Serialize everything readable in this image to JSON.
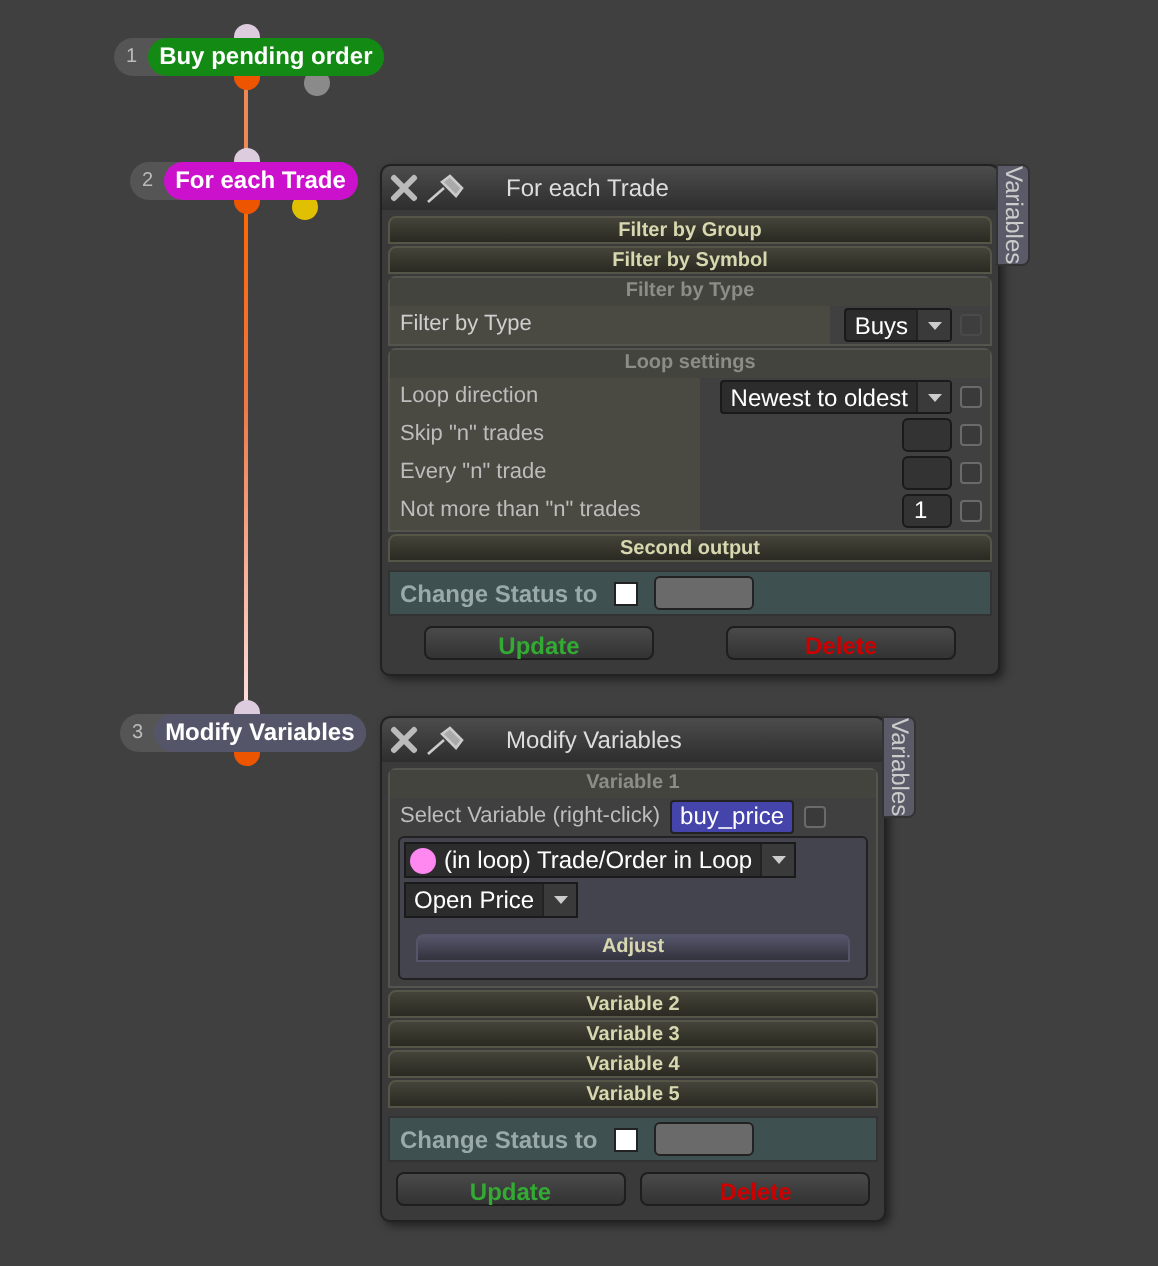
{
  "nodes": [
    {
      "number": "1",
      "label": "Buy pending order",
      "color": "#138a13",
      "side_port": {
        "color": "#8a8a8a"
      }
    },
    {
      "number": "2",
      "label": "For each Trade",
      "color": "#cc11cc",
      "side_port": {
        "color": "#e0c000"
      }
    },
    {
      "number": "3",
      "label": "Modify Variables",
      "color": "#55556a"
    }
  ],
  "panels": [
    {
      "title": "For each Trade",
      "tab": "Variables",
      "sections": [
        {
          "kind": "bar",
          "label": "Filter by Group"
        },
        {
          "kind": "bar",
          "label": "Filter by Symbol"
        },
        {
          "kind": "group",
          "label": "Filter by Type",
          "rows": [
            {
              "kind": "select",
              "label": "Filter by Type",
              "value": "Buys",
              "checked": false,
              "disabled": true
            }
          ]
        },
        {
          "kind": "group",
          "label": "Loop settings",
          "rows": [
            {
              "kind": "select",
              "label": "Loop direction",
              "value": "Newest to oldest",
              "checked": false,
              "disabled": false
            },
            {
              "kind": "number",
              "label": "Skip \"n\" trades",
              "checked": false,
              "disabled": false
            },
            {
              "kind": "number",
              "label": "Every \"n\" trade",
              "checked": false,
              "disabled": false
            },
            {
              "kind": "number",
              "label": "Not more than \"n\" trades",
              "value": "1",
              "checked": false,
              "disabled": false
            }
          ]
        },
        {
          "kind": "bar",
          "label": "Second output"
        }
      ],
      "status_label": "Change Status to",
      "buttons": [
        {
          "kind": "update",
          "label": "Update"
        },
        {
          "kind": "delete",
          "label": "Delete"
        }
      ]
    },
    {
      "title": "Modify Variables",
      "tab": "Variables",
      "sections": [
        {
          "kind": "variable",
          "label": "Variable 1",
          "select_label": "Select Variable (right-click)",
          "variable": "buy_price",
          "checked": false,
          "source": {
            "label": "(in loop) Trade/Order in Loop",
            "color": "#ff88f0"
          },
          "property": "Open Price",
          "adjust": "Adjust"
        },
        {
          "kind": "bar",
          "label": "Variable 2"
        },
        {
          "kind": "bar",
          "label": "Variable 3"
        },
        {
          "kind": "bar",
          "label": "Variable 4"
        },
        {
          "kind": "bar",
          "label": "Variable 5"
        }
      ],
      "status_label": "Change Status to",
      "buttons": [
        {
          "kind": "update",
          "label": "Update"
        },
        {
          "kind": "delete",
          "label": "Delete"
        }
      ]
    }
  ]
}
